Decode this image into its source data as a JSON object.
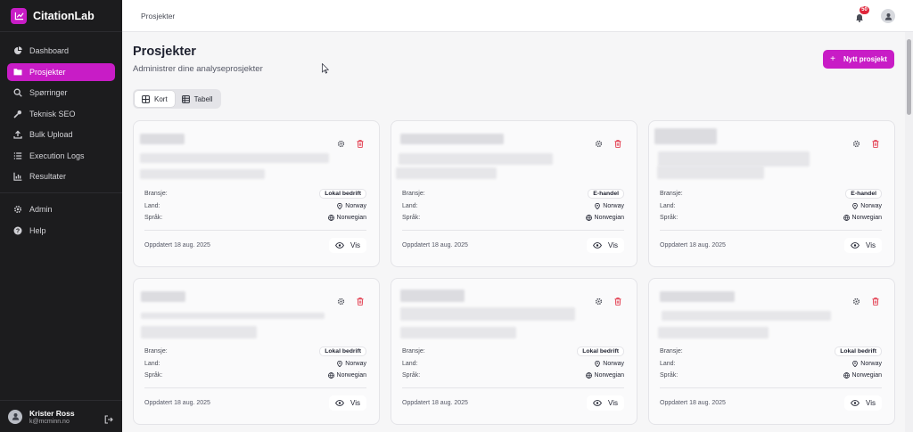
{
  "app": {
    "name": "CitationLab"
  },
  "sidebar": {
    "items": [
      {
        "label": "Dashboard",
        "icon": "pie-chart-icon"
      },
      {
        "label": "Prosjekter",
        "icon": "folder-icon",
        "active": true
      },
      {
        "label": "Spørringer",
        "icon": "search-icon"
      },
      {
        "label": "Teknisk SEO",
        "icon": "wrench-icon"
      },
      {
        "label": "Bulk Upload",
        "icon": "upload-icon"
      },
      {
        "label": "Execution Logs",
        "icon": "list-icon"
      },
      {
        "label": "Resultater",
        "icon": "bar-chart-icon"
      }
    ],
    "secondary": [
      {
        "label": "Admin",
        "icon": "gear-icon"
      },
      {
        "label": "Help",
        "icon": "help-icon"
      }
    ],
    "user": {
      "name": "Krister Ross",
      "email": "k@mcminn.no"
    }
  },
  "topbar": {
    "breadcrumb": "Prosjekter",
    "notifications": "50"
  },
  "page": {
    "title": "Prosjekter",
    "subtitle": "Administrer dine analyseprosjekter",
    "new_button": "Nytt prosjekt"
  },
  "view_toggle": {
    "cards": "Kort",
    "table": "Tabell",
    "active": "cards"
  },
  "labels": {
    "industry": "Bransje:",
    "country": "Land:",
    "language": "Språk:",
    "view": "Vis"
  },
  "projects": [
    {
      "industry": "Lokal bedrift",
      "country": "Norway",
      "language": "Norwegian",
      "updated": "Oppdatert 18 aug. 2025"
    },
    {
      "industry": "E-handel",
      "country": "Norway",
      "language": "Norwegian",
      "updated": "Oppdatert 18 aug. 2025"
    },
    {
      "industry": "E-handel",
      "country": "Norway",
      "language": "Norwegian",
      "updated": "Oppdatert 18 aug. 2025"
    },
    {
      "industry": "Lokal bedrift",
      "country": "Norway",
      "language": "Norwegian",
      "updated": "Oppdatert 18 aug. 2025"
    },
    {
      "industry": "Lokal bedrift",
      "country": "Norway",
      "language": "Norwegian",
      "updated": "Oppdatert 18 aug. 2025"
    },
    {
      "industry": "Lokal bedrift",
      "country": "Norway",
      "language": "Norwegian",
      "updated": "Oppdatert 18 aug. 2025"
    }
  ],
  "colors": {
    "accent": "#c81cc6",
    "sidebar": "#1c1c1e",
    "danger": "#e0263b"
  }
}
